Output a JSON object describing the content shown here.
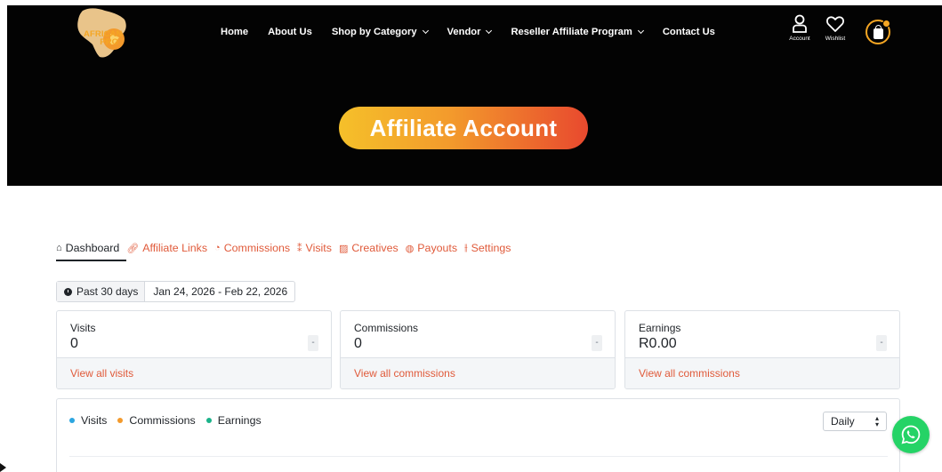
{
  "brand": {
    "logo_line1": "AFRICAN",
    "logo_line2": "PRO"
  },
  "nav": {
    "items": [
      {
        "label": "Home",
        "has_dropdown": false
      },
      {
        "label": "About Us",
        "has_dropdown": false
      },
      {
        "label": "Shop by Category",
        "has_dropdown": true
      },
      {
        "label": "Vendor",
        "has_dropdown": true
      },
      {
        "label": "Reseller Affiliate Program",
        "has_dropdown": true
      },
      {
        "label": "Contact Us",
        "has_dropdown": false
      }
    ],
    "account_label": "Account",
    "wishlist_label": "Wishlist"
  },
  "hero": {
    "title": "Affiliate Account"
  },
  "tabs": [
    {
      "label": "Dashboard",
      "icon": "home-icon",
      "active": true
    },
    {
      "label": "Affiliate Links",
      "icon": "link-icon",
      "active": false
    },
    {
      "label": "Commissions",
      "icon": "pie-icon",
      "active": false
    },
    {
      "label": "Visits",
      "icon": "sparkle-icon",
      "active": false
    },
    {
      "label": "Creatives",
      "icon": "creatives-icon",
      "active": false
    },
    {
      "label": "Payouts",
      "icon": "money-icon",
      "active": false
    },
    {
      "label": "Settings",
      "icon": "sliders-icon",
      "active": false
    }
  ],
  "date_filter": {
    "preset": "Past 30 days",
    "range": "Jan 24, 2026 - Feb 22, 2026"
  },
  "stats": [
    {
      "label": "Visits",
      "value": "0",
      "delta": "-",
      "link": "View all visits"
    },
    {
      "label": "Commissions",
      "value": "0",
      "delta": "-",
      "link": "View all commissions"
    },
    {
      "label": "Earnings",
      "value": "R0.00",
      "delta": "-",
      "link": "View all commissions"
    }
  ],
  "chart": {
    "legend": [
      {
        "label": "Visits",
        "color": "#2ca6e0"
      },
      {
        "label": "Commissions",
        "color": "#f39a2c"
      },
      {
        "label": "Earnings",
        "color": "#1bb38a"
      }
    ],
    "period": "Daily"
  },
  "colors": {
    "accent": "#e05a3a",
    "brand_orange": "#f5a623",
    "whatsapp": "#25d366"
  }
}
